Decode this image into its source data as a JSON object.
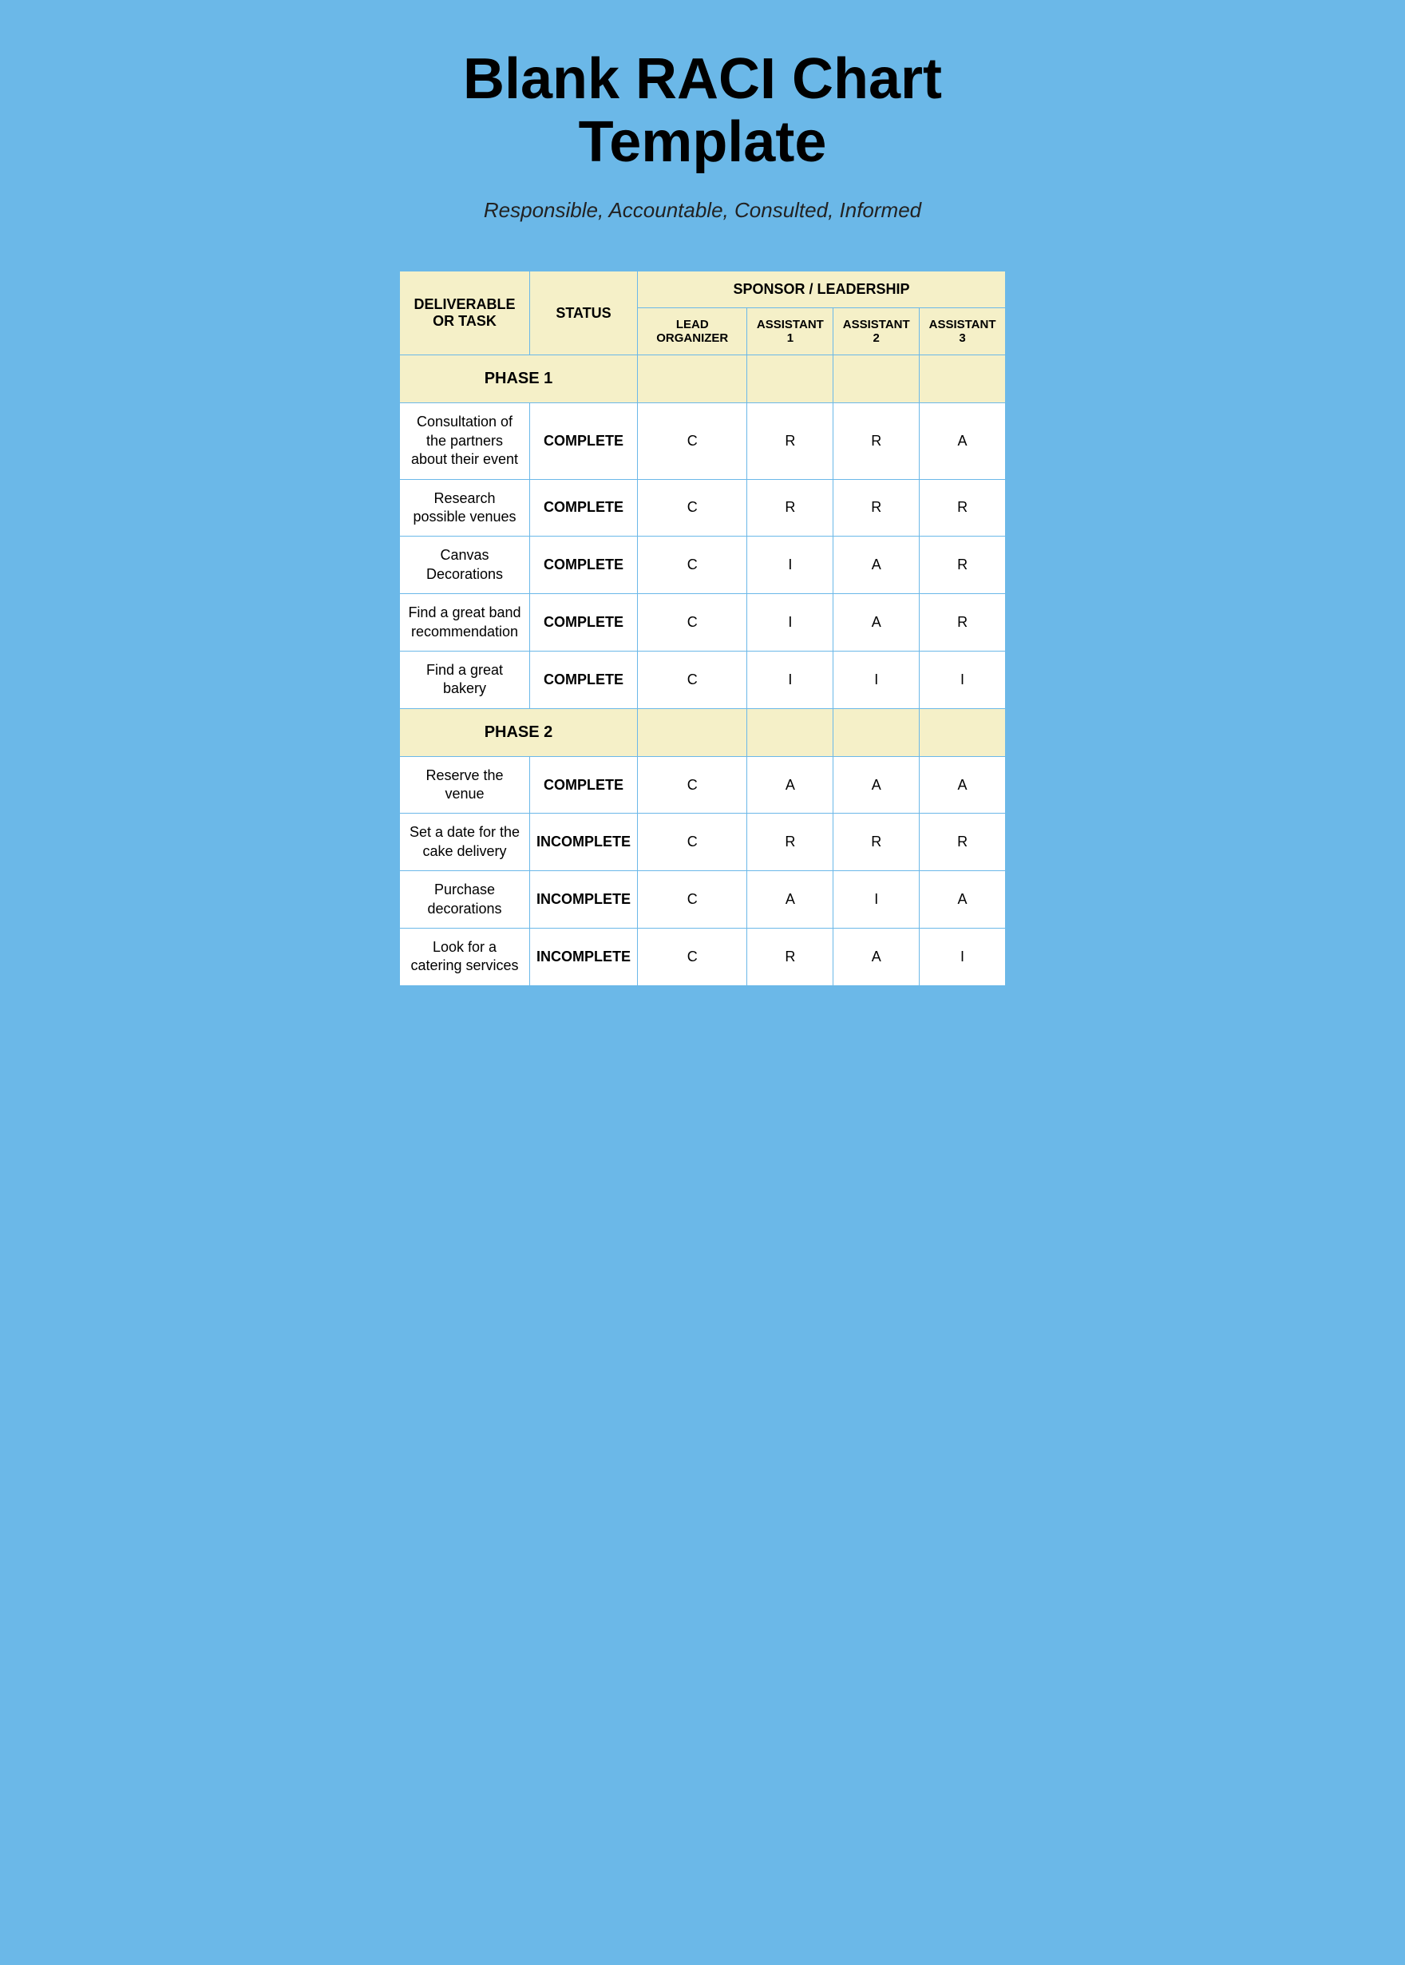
{
  "title": "Blank RACI Chart Template",
  "subtitle": "Responsible, Accountable, Consulted, Informed",
  "headers": {
    "col1": "DELIVERABLE OR TASK",
    "col2": "STATUS",
    "sponsor": "SPONSOR / LEADERSHIP",
    "phase1": "PHASE 1",
    "phase2": "PHASE 2",
    "lead": "LEAD ORGANIZER",
    "asst1": "ASSISTANT 1",
    "asst2": "ASSISTANT 2",
    "asst3": "ASSISTANT 3"
  },
  "phase1_rows": [
    {
      "task": "Consultation of the partners about their event",
      "status": "COMPLETE",
      "lead": "C",
      "a1": "R",
      "a2": "R",
      "a3": "A"
    },
    {
      "task": "Research possible venues",
      "status": "COMPLETE",
      "lead": "C",
      "a1": "R",
      "a2": "R",
      "a3": "R"
    },
    {
      "task": "Canvas Decorations",
      "status": "COMPLETE",
      "lead": "C",
      "a1": "I",
      "a2": "A",
      "a3": "R"
    },
    {
      "task": "Find a great band recommendation",
      "status": "COMPLETE",
      "lead": "C",
      "a1": "I",
      "a2": "A",
      "a3": "R"
    },
    {
      "task": "Find a great bakery",
      "status": "COMPLETE",
      "lead": "C",
      "a1": "I",
      "a2": "I",
      "a3": "I"
    }
  ],
  "phase2_rows": [
    {
      "task": "Reserve the venue",
      "status": "COMPLETE",
      "lead": "C",
      "a1": "A",
      "a2": "A",
      "a3": "A"
    },
    {
      "task": "Set a date for the cake delivery",
      "status": "INCOMPLETE",
      "lead": "C",
      "a1": "R",
      "a2": "R",
      "a3": "R"
    },
    {
      "task": "Purchase decorations",
      "status": "INCOMPLETE",
      "lead": "C",
      "a1": "A",
      "a2": "I",
      "a3": "A"
    },
    {
      "task": "Look for a catering services",
      "status": "INCOMPLETE",
      "lead": "C",
      "a1": "R",
      "a2": "A",
      "a3": "I"
    }
  ]
}
